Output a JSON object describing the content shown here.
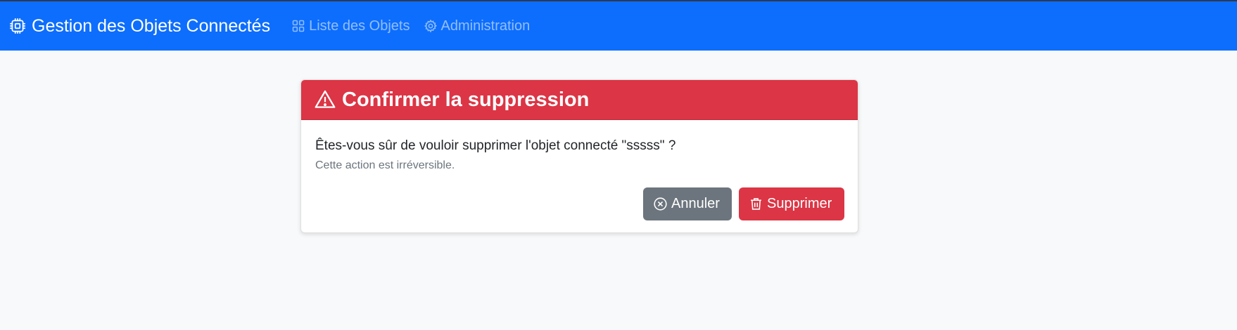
{
  "navbar": {
    "brand": "Gestion des Objets Connectés",
    "brand_icon": "cpu-icon",
    "links": [
      {
        "label": "Liste des Objets",
        "icon": "grid-icon"
      },
      {
        "label": "Administration",
        "icon": "gear-icon"
      }
    ],
    "bg_color": "#0d6efd"
  },
  "dialog": {
    "title": "Confirmer la suppression",
    "title_icon": "warning-icon",
    "header_color": "#dc3545",
    "question": "Êtes-vous sûr de vouloir supprimer l'objet connecté \"sssss\" ?",
    "note": "Cette action est irréversible.",
    "cancel_label": "Annuler",
    "cancel_icon": "x-circle-icon",
    "cancel_color": "#6c757d",
    "delete_label": "Supprimer",
    "delete_icon": "trash-icon",
    "delete_color": "#dc3545"
  }
}
